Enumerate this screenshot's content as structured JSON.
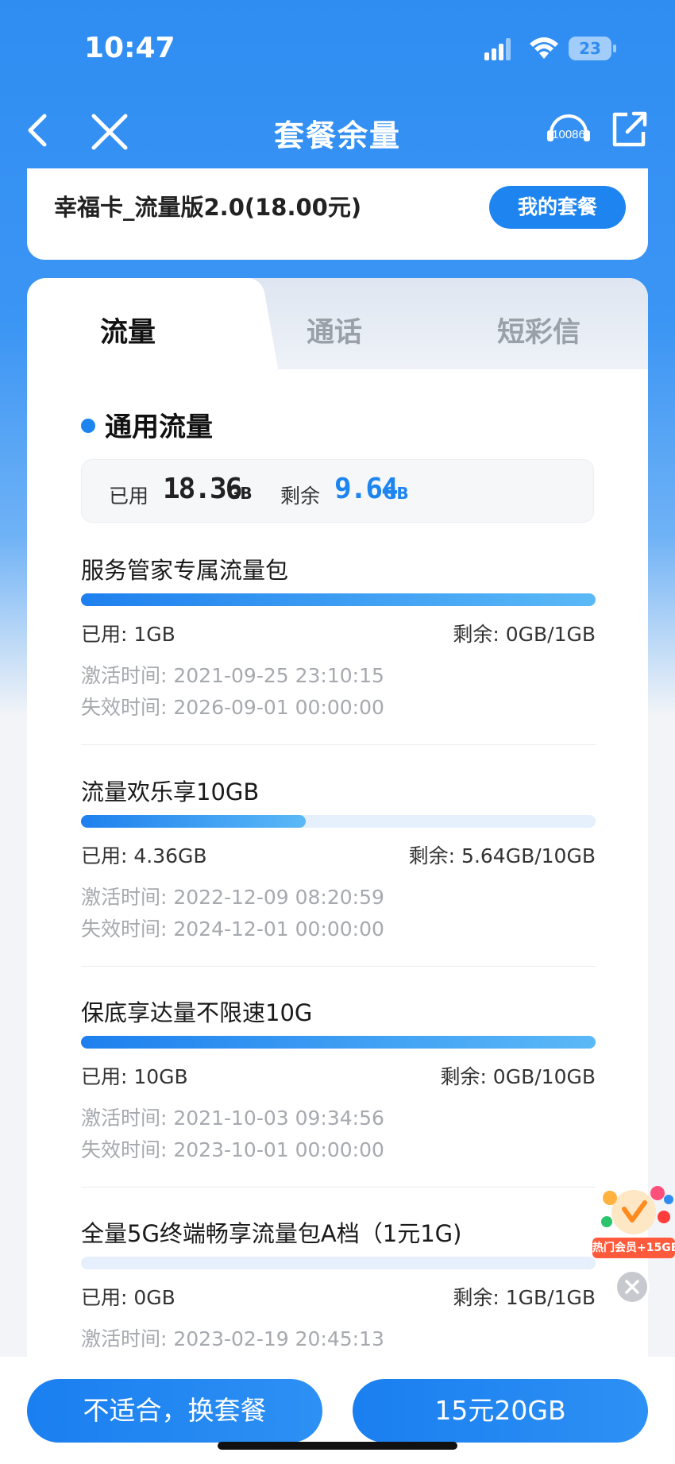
{
  "status_bar": {
    "time": "10:47",
    "battery": "23"
  },
  "nav": {
    "title": "套餐余量",
    "hotline_label": "10086",
    "icons": [
      "back-icon",
      "close-icon",
      "customer-service-icon",
      "share-icon"
    ]
  },
  "plan": {
    "name": "幸福卡_流量版2.0(18.00元)",
    "my_plan_button": "我的套餐"
  },
  "tabs": [
    {
      "label": "流量",
      "active": true
    },
    {
      "label": "通话",
      "active": false
    },
    {
      "label": "短彩信",
      "active": false
    }
  ],
  "section": {
    "title": "通用流量",
    "used_label": "已用",
    "used_value": "18.36",
    "used_unit": "GB",
    "remain_label": "剩余",
    "remain_value": "9.64",
    "remain_unit": "GB"
  },
  "packages": [
    {
      "name": "服务管家专属流量包",
      "used": "已用: 1GB",
      "remain": "剩余: 0GB/1GB",
      "used_fraction": 1.0,
      "activated": "激活时间: 2021-09-25 23:10:15",
      "expires": "失效时间: 2026-09-01 00:00:00"
    },
    {
      "name": "流量欢乐享10GB",
      "used": "已用: 4.36GB",
      "remain": "剩余: 5.64GB/10GB",
      "used_fraction": 0.436,
      "activated": "激活时间: 2022-12-09 08:20:59",
      "expires": "失效时间: 2024-12-01 00:00:00"
    },
    {
      "name": "保底享达量不限速10G",
      "used": "已用: 10GB",
      "remain": "剩余: 0GB/10GB",
      "used_fraction": 1.0,
      "activated": "激活时间: 2021-10-03 09:34:56",
      "expires": "失效时间: 2023-10-01 00:00:00"
    },
    {
      "name": "全量5G终端畅享流量包A档（1元1G)",
      "used": "已用: 0GB",
      "remain": "剩余: 1GB/1GB",
      "used_fraction": 0.0,
      "activated": "激活时间: 2023-02-19 20:45:13",
      "expires": ""
    }
  ],
  "promo": {
    "tag": "热门会员+15GB"
  },
  "bottom": {
    "left_button": "不适合，换套餐",
    "right_button": "15元20GB"
  },
  "colors": {
    "primary": "#1e85f0",
    "header_bg": "#2f8df2",
    "muted_text": "#a6a9ae"
  }
}
